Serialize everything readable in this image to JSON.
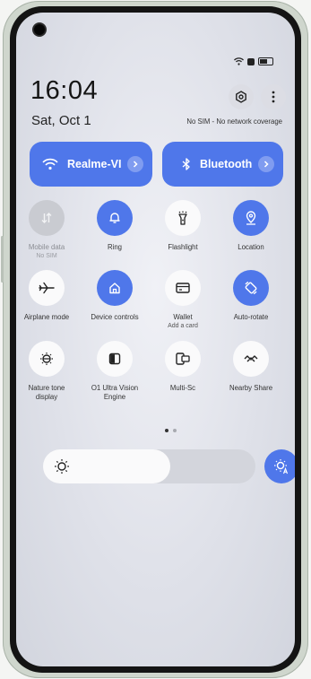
{
  "status": {
    "time": "16:04",
    "date": "Sat, Oct 1",
    "network": "No SIM - No network coverage",
    "icons": [
      "wifi-icon",
      "sim-icon",
      "battery-icon"
    ]
  },
  "header_buttons": [
    "settings-icon",
    "more-icon"
  ],
  "pills": {
    "wifi": {
      "label": "Realme-VI",
      "icon": "wifi-icon"
    },
    "bluetooth": {
      "label": "Bluetooth",
      "icon": "bluetooth-icon"
    }
  },
  "tiles": [
    {
      "label": "Mobile data",
      "sub": "No SIM",
      "state": "disabled",
      "icon": "mobile-data-icon"
    },
    {
      "label": "Ring",
      "sub": "",
      "state": "on",
      "icon": "bell-icon"
    },
    {
      "label": "Flashlight",
      "sub": "",
      "state": "off",
      "icon": "flashlight-icon"
    },
    {
      "label": "Location",
      "sub": "",
      "state": "on",
      "icon": "location-icon"
    },
    {
      "label": "Airplane mode",
      "sub": "",
      "state": "off",
      "icon": "airplane-icon"
    },
    {
      "label": "Device controls",
      "sub": "",
      "state": "on",
      "icon": "home-icon"
    },
    {
      "label": "Wallet",
      "sub": "Add a card",
      "state": "off",
      "icon": "wallet-icon"
    },
    {
      "label": "Auto-rotate",
      "sub": "",
      "state": "on",
      "icon": "rotate-icon"
    },
    {
      "label": "Nature tone display",
      "sub": "",
      "state": "off",
      "icon": "nature-tone-icon"
    },
    {
      "label": "O1 Ultra Vision Engine",
      "sub": "",
      "state": "off",
      "icon": "vision-engine-icon"
    },
    {
      "label": "Multi-Sc",
      "sub": "",
      "state": "off",
      "icon": "multi-screen-icon"
    },
    {
      "label": "Nearby Share",
      "sub": "",
      "state": "off",
      "icon": "nearby-share-icon"
    }
  ],
  "pager": {
    "pages": 2,
    "current": 1
  },
  "brightness": {
    "level": 0.6,
    "auto_icon": "auto-brightness-icon"
  },
  "colors": {
    "accent": "#4f77ea",
    "tile_off": "#fafafb",
    "disabled": "#c9cbd1"
  }
}
